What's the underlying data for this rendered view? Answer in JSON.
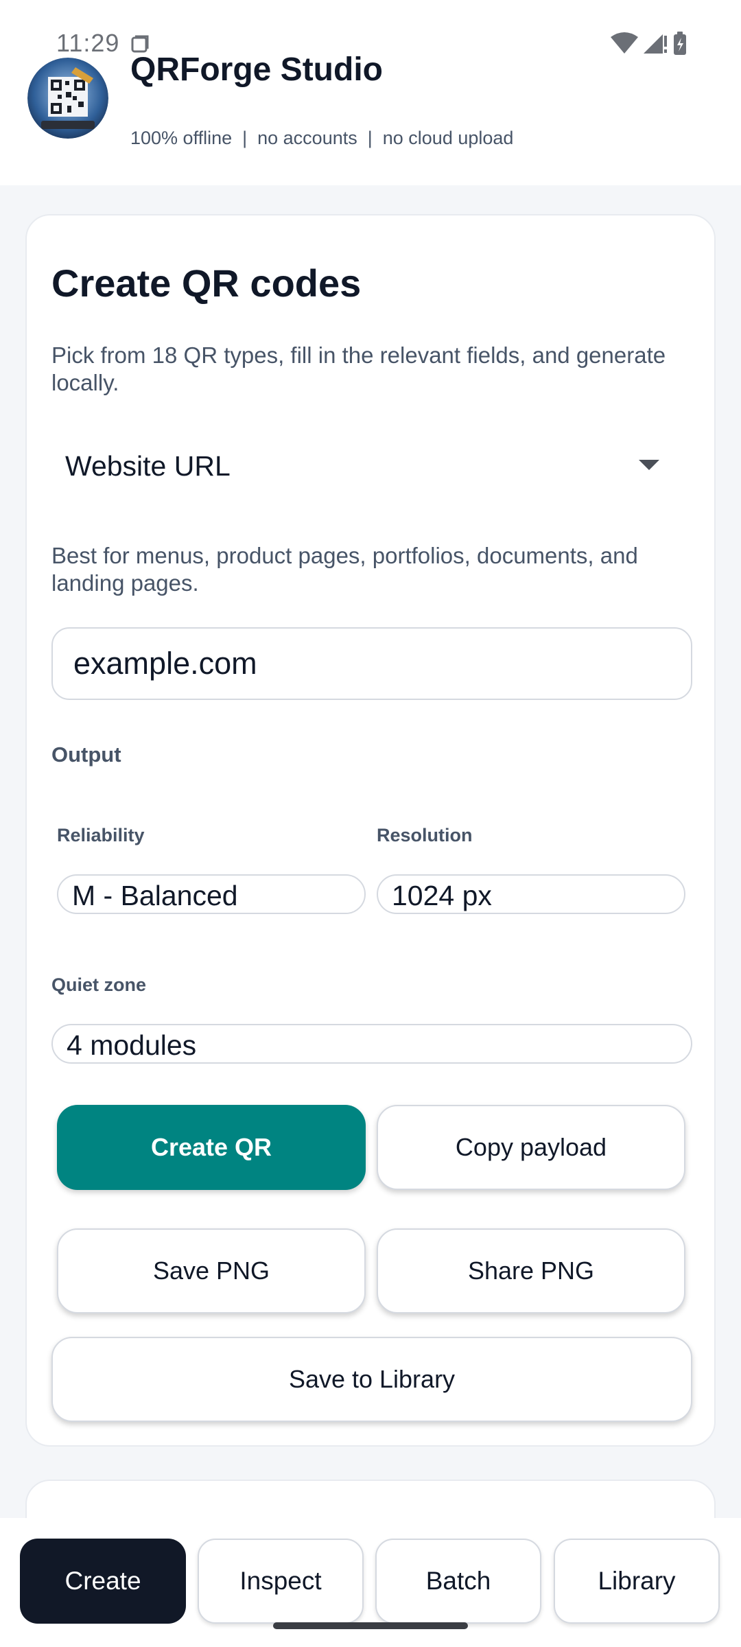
{
  "status_bar": {
    "time": "11:29"
  },
  "app": {
    "title": "QRForge Studio",
    "subtitle": "100% offline  |  no accounts  |  no cloud upload"
  },
  "create_card": {
    "title": "Create QR codes",
    "description": "Pick from 18 QR types, fill in the relevant fields, and generate locally.",
    "qr_type": {
      "selected": "Website URL"
    },
    "type_hint": "Best for menus, product pages, portfolios, documents, and landing pages.",
    "url_field": {
      "value": "example.com"
    },
    "output": {
      "section_label": "Output",
      "reliability_label": "Reliability",
      "reliability_value": "M - Balanced",
      "resolution_label": "Resolution",
      "resolution_value": "1024 px",
      "quiet_zone_label": "Quiet zone",
      "quiet_zone_value": "4 modules"
    },
    "buttons": {
      "create": "Create QR",
      "copy": "Copy payload",
      "save_png": "Save PNG",
      "share_png": "Share PNG",
      "save_library": "Save to Library"
    }
  },
  "bottom_nav": {
    "tabs": [
      {
        "label": "Create"
      },
      {
        "label": "Inspect"
      },
      {
        "label": "Batch"
      },
      {
        "label": "Library"
      }
    ]
  },
  "colors": {
    "primary": "#008481",
    "nav_active": "#111827",
    "text": "#101828",
    "muted_text": "#475467",
    "background": "#f4f6f9"
  }
}
